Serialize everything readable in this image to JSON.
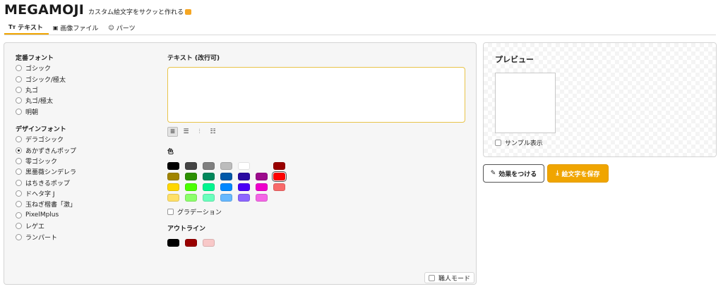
{
  "app": {
    "logo": "MEGAMOJI",
    "tagline": "カスタム絵文字をサクッと作れる"
  },
  "tabs": [
    {
      "icon": "Tт",
      "label": "テキスト",
      "active": true
    },
    {
      "icon": "▣",
      "label": "画像ファイル",
      "active": false
    },
    {
      "icon": "☺",
      "label": "パーツ",
      "active": false
    }
  ],
  "fonts": {
    "standard_label": "定番フォント",
    "standard": [
      "ゴシック",
      "ゴシック/極太",
      "丸ゴ",
      "丸ゴ/極太",
      "明朝"
    ],
    "design_label": "デザインフォント",
    "design": [
      "デラゴシック",
      "あかずきんポップ",
      "零ゴシック",
      "黒薔薇シンデレラ",
      "はちきるポップ",
      "ドヘタ字 J",
      "玉ねぎ楷書「激」",
      "PixelMplus",
      "レゲエ",
      "ランパート"
    ],
    "selected_design": "あかずきんポップ"
  },
  "text_section": {
    "label": "テキスト (改行可)",
    "value": ""
  },
  "align_buttons": [
    "≣",
    "☰",
    "⫶",
    "☷"
  ],
  "color": {
    "label": "色",
    "swatches": [
      [
        "#000000",
        "#444444",
        "#808080",
        "#bcbcbc",
        "#ffffff"
      ],
      [
        "#990000",
        "#a08400",
        "#2b8f00",
        "#00875a",
        "#0058a8",
        "#2a0aa0",
        "#9c0a8c"
      ],
      [
        "#ff0000",
        "#ffd700",
        "#4cff00",
        "#00f58f",
        "#0088ff",
        "#4b00f5",
        "#ee00cc"
      ],
      [
        "#f86a6a",
        "#ffe066",
        "#8cff6a",
        "#6affbd",
        "#66b8ff",
        "#8d66ff",
        "#f466e6"
      ]
    ],
    "selected": "#ff0000",
    "gradient_label": "グラデーション"
  },
  "outline": {
    "label": "アウトライン",
    "swatches": [
      "#000000",
      "#990000",
      "#f8c8c8"
    ]
  },
  "mode": {
    "label": "職人モード"
  },
  "preview": {
    "title": "プレビュー",
    "sample_label": "サンプル表示"
  },
  "buttons": {
    "effect_label": "効果をつける",
    "save_label": "絵文字を保存"
  }
}
